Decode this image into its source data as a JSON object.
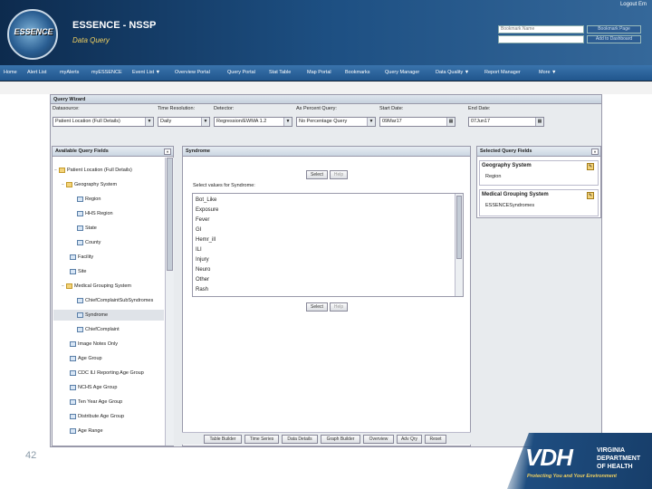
{
  "header": {
    "logo_text": "ESSENCE",
    "title": "ESSENCE - NSSP",
    "subtitle": "Data Query",
    "logout": "Logout Em",
    "bookmark_placeholder": "Bookmark Name",
    "buttons": [
      "Bookmark Page",
      "Add to Dashboard"
    ]
  },
  "nav": {
    "items": [
      "Home",
      "Alert List",
      "myAlerts",
      "myESSENCE",
      "Event List ▼",
      "Overview Portal",
      "Query Portal",
      "Stat Table",
      "Map Portal",
      "Bookmarks",
      "Query Manager",
      "Data Quality ▼",
      "Report Manager",
      "More ▼"
    ]
  },
  "wizard": {
    "title": "Query Wizard",
    "fields": [
      {
        "label": "Datasource:",
        "value": "Patient Location (Full Details)"
      },
      {
        "label": "Time Resolution:",
        "value": "Daily"
      },
      {
        "label": "Detector:",
        "value": "Regression/EWMA 1.2"
      },
      {
        "label": "As Percent Query:",
        "value": "No Percentage Query"
      },
      {
        "label": "Start Date:",
        "value": "09Mar17"
      },
      {
        "label": "End Date:",
        "value": "07Jun17"
      }
    ],
    "available": {
      "title": "Available Query Fields",
      "collapse": "«",
      "items": [
        {
          "label": "Patient Location (Full Details)",
          "type": "folder",
          "toggle": "−"
        },
        {
          "label": "Geography System",
          "type": "folder",
          "toggle": "−"
        },
        {
          "label": "Region",
          "type": "leaf",
          "toggle": ""
        },
        {
          "label": "HHS Region",
          "type": "leaf",
          "toggle": ""
        },
        {
          "label": "State",
          "type": "leaf",
          "toggle": ""
        },
        {
          "label": "County",
          "type": "leaf",
          "toggle": ""
        },
        {
          "label": "Facility",
          "type": "leaf",
          "toggle": ""
        },
        {
          "label": "Site",
          "type": "leaf",
          "toggle": ""
        },
        {
          "label": "Medical Grouping System",
          "type": "folder",
          "toggle": "−"
        },
        {
          "label": "ChiefComplaintSubSyndromes",
          "type": "leaf",
          "toggle": ""
        },
        {
          "label": "Syndrome",
          "type": "leaf",
          "toggle": ""
        },
        {
          "label": "ChiefComplaint",
          "type": "leaf",
          "toggle": ""
        },
        {
          "label": "Image Notes Only",
          "type": "leaf",
          "toggle": ""
        },
        {
          "label": "Age Group",
          "type": "leaf",
          "toggle": ""
        },
        {
          "label": "CDC ILI Reporting Age Group",
          "type": "leaf",
          "toggle": ""
        },
        {
          "label": "NCHS Age Group",
          "type": "leaf",
          "toggle": ""
        },
        {
          "label": "Ten Year Age Group",
          "type": "leaf",
          "toggle": ""
        },
        {
          "label": "Distribute Age Group",
          "type": "leaf",
          "toggle": ""
        },
        {
          "label": "Age Range",
          "type": "leaf",
          "toggle": ""
        }
      ]
    },
    "syndrome": {
      "title": "Syndrome",
      "select": "Select",
      "help": "Help",
      "prompt": "Select values for Syndrome:",
      "values": [
        "Bot_Like",
        "Exposure",
        "Fever",
        "GI",
        "Hemr_ill",
        "ILI",
        "Injury",
        "Neuro",
        "Other",
        "Rash"
      ]
    },
    "selected": {
      "title": "Selected Query Fields",
      "collapse": "»",
      "groups": [
        {
          "name": "Geography System",
          "value": "Region"
        },
        {
          "name": "Medical Grouping System",
          "value": "ESSENCESyndromes"
        }
      ]
    },
    "bottom_buttons": [
      "Table Builder",
      "Time Series",
      "Data Details",
      "Graph Builder",
      "Overview",
      "Adv Qry",
      "Reset"
    ]
  },
  "footer": {
    "page_number": "42",
    "vdh": "VDH",
    "vdh_name": [
      "VIRGINIA",
      "DEPARTMENT",
      "OF HEALTH"
    ],
    "tagline": "Protecting You and Your Environment"
  }
}
